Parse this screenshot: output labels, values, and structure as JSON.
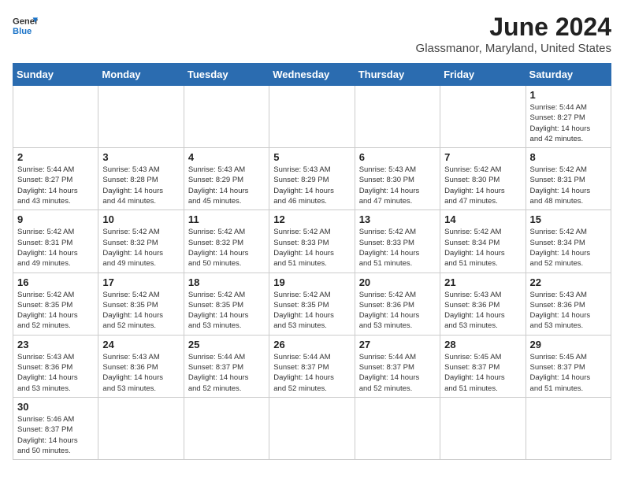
{
  "header": {
    "logo_general": "General",
    "logo_blue": "Blue",
    "month_title": "June 2024",
    "location": "Glassmanor, Maryland, United States"
  },
  "days_of_week": [
    "Sunday",
    "Monday",
    "Tuesday",
    "Wednesday",
    "Thursday",
    "Friday",
    "Saturday"
  ],
  "weeks": [
    [
      {
        "day": "",
        "info": ""
      },
      {
        "day": "",
        "info": ""
      },
      {
        "day": "",
        "info": ""
      },
      {
        "day": "",
        "info": ""
      },
      {
        "day": "",
        "info": ""
      },
      {
        "day": "",
        "info": ""
      },
      {
        "day": "1",
        "info": "Sunrise: 5:44 AM\nSunset: 8:27 PM\nDaylight: 14 hours\nand 42 minutes."
      }
    ],
    [
      {
        "day": "2",
        "info": "Sunrise: 5:44 AM\nSunset: 8:27 PM\nDaylight: 14 hours\nand 43 minutes."
      },
      {
        "day": "3",
        "info": "Sunrise: 5:43 AM\nSunset: 8:28 PM\nDaylight: 14 hours\nand 44 minutes."
      },
      {
        "day": "4",
        "info": "Sunrise: 5:43 AM\nSunset: 8:29 PM\nDaylight: 14 hours\nand 45 minutes."
      },
      {
        "day": "5",
        "info": "Sunrise: 5:43 AM\nSunset: 8:29 PM\nDaylight: 14 hours\nand 46 minutes."
      },
      {
        "day": "6",
        "info": "Sunrise: 5:43 AM\nSunset: 8:30 PM\nDaylight: 14 hours\nand 47 minutes."
      },
      {
        "day": "7",
        "info": "Sunrise: 5:42 AM\nSunset: 8:30 PM\nDaylight: 14 hours\nand 47 minutes."
      },
      {
        "day": "8",
        "info": "Sunrise: 5:42 AM\nSunset: 8:31 PM\nDaylight: 14 hours\nand 48 minutes."
      }
    ],
    [
      {
        "day": "9",
        "info": "Sunrise: 5:42 AM\nSunset: 8:31 PM\nDaylight: 14 hours\nand 49 minutes."
      },
      {
        "day": "10",
        "info": "Sunrise: 5:42 AM\nSunset: 8:32 PM\nDaylight: 14 hours\nand 49 minutes."
      },
      {
        "day": "11",
        "info": "Sunrise: 5:42 AM\nSunset: 8:32 PM\nDaylight: 14 hours\nand 50 minutes."
      },
      {
        "day": "12",
        "info": "Sunrise: 5:42 AM\nSunset: 8:33 PM\nDaylight: 14 hours\nand 51 minutes."
      },
      {
        "day": "13",
        "info": "Sunrise: 5:42 AM\nSunset: 8:33 PM\nDaylight: 14 hours\nand 51 minutes."
      },
      {
        "day": "14",
        "info": "Sunrise: 5:42 AM\nSunset: 8:34 PM\nDaylight: 14 hours\nand 51 minutes."
      },
      {
        "day": "15",
        "info": "Sunrise: 5:42 AM\nSunset: 8:34 PM\nDaylight: 14 hours\nand 52 minutes."
      }
    ],
    [
      {
        "day": "16",
        "info": "Sunrise: 5:42 AM\nSunset: 8:35 PM\nDaylight: 14 hours\nand 52 minutes."
      },
      {
        "day": "17",
        "info": "Sunrise: 5:42 AM\nSunset: 8:35 PM\nDaylight: 14 hours\nand 52 minutes."
      },
      {
        "day": "18",
        "info": "Sunrise: 5:42 AM\nSunset: 8:35 PM\nDaylight: 14 hours\nand 53 minutes."
      },
      {
        "day": "19",
        "info": "Sunrise: 5:42 AM\nSunset: 8:35 PM\nDaylight: 14 hours\nand 53 minutes."
      },
      {
        "day": "20",
        "info": "Sunrise: 5:42 AM\nSunset: 8:36 PM\nDaylight: 14 hours\nand 53 minutes."
      },
      {
        "day": "21",
        "info": "Sunrise: 5:43 AM\nSunset: 8:36 PM\nDaylight: 14 hours\nand 53 minutes."
      },
      {
        "day": "22",
        "info": "Sunrise: 5:43 AM\nSunset: 8:36 PM\nDaylight: 14 hours\nand 53 minutes."
      }
    ],
    [
      {
        "day": "23",
        "info": "Sunrise: 5:43 AM\nSunset: 8:36 PM\nDaylight: 14 hours\nand 53 minutes."
      },
      {
        "day": "24",
        "info": "Sunrise: 5:43 AM\nSunset: 8:36 PM\nDaylight: 14 hours\nand 53 minutes."
      },
      {
        "day": "25",
        "info": "Sunrise: 5:44 AM\nSunset: 8:37 PM\nDaylight: 14 hours\nand 52 minutes."
      },
      {
        "day": "26",
        "info": "Sunrise: 5:44 AM\nSunset: 8:37 PM\nDaylight: 14 hours\nand 52 minutes."
      },
      {
        "day": "27",
        "info": "Sunrise: 5:44 AM\nSunset: 8:37 PM\nDaylight: 14 hours\nand 52 minutes."
      },
      {
        "day": "28",
        "info": "Sunrise: 5:45 AM\nSunset: 8:37 PM\nDaylight: 14 hours\nand 51 minutes."
      },
      {
        "day": "29",
        "info": "Sunrise: 5:45 AM\nSunset: 8:37 PM\nDaylight: 14 hours\nand 51 minutes."
      }
    ],
    [
      {
        "day": "30",
        "info": "Sunrise: 5:46 AM\nSunset: 8:37 PM\nDaylight: 14 hours\nand 50 minutes."
      },
      {
        "day": "",
        "info": ""
      },
      {
        "day": "",
        "info": ""
      },
      {
        "day": "",
        "info": ""
      },
      {
        "day": "",
        "info": ""
      },
      {
        "day": "",
        "info": ""
      },
      {
        "day": "",
        "info": ""
      }
    ]
  ],
  "colors": {
    "header_bg": "#2b6cb0",
    "header_text": "#ffffff",
    "accent_blue": "#1a73c8"
  }
}
